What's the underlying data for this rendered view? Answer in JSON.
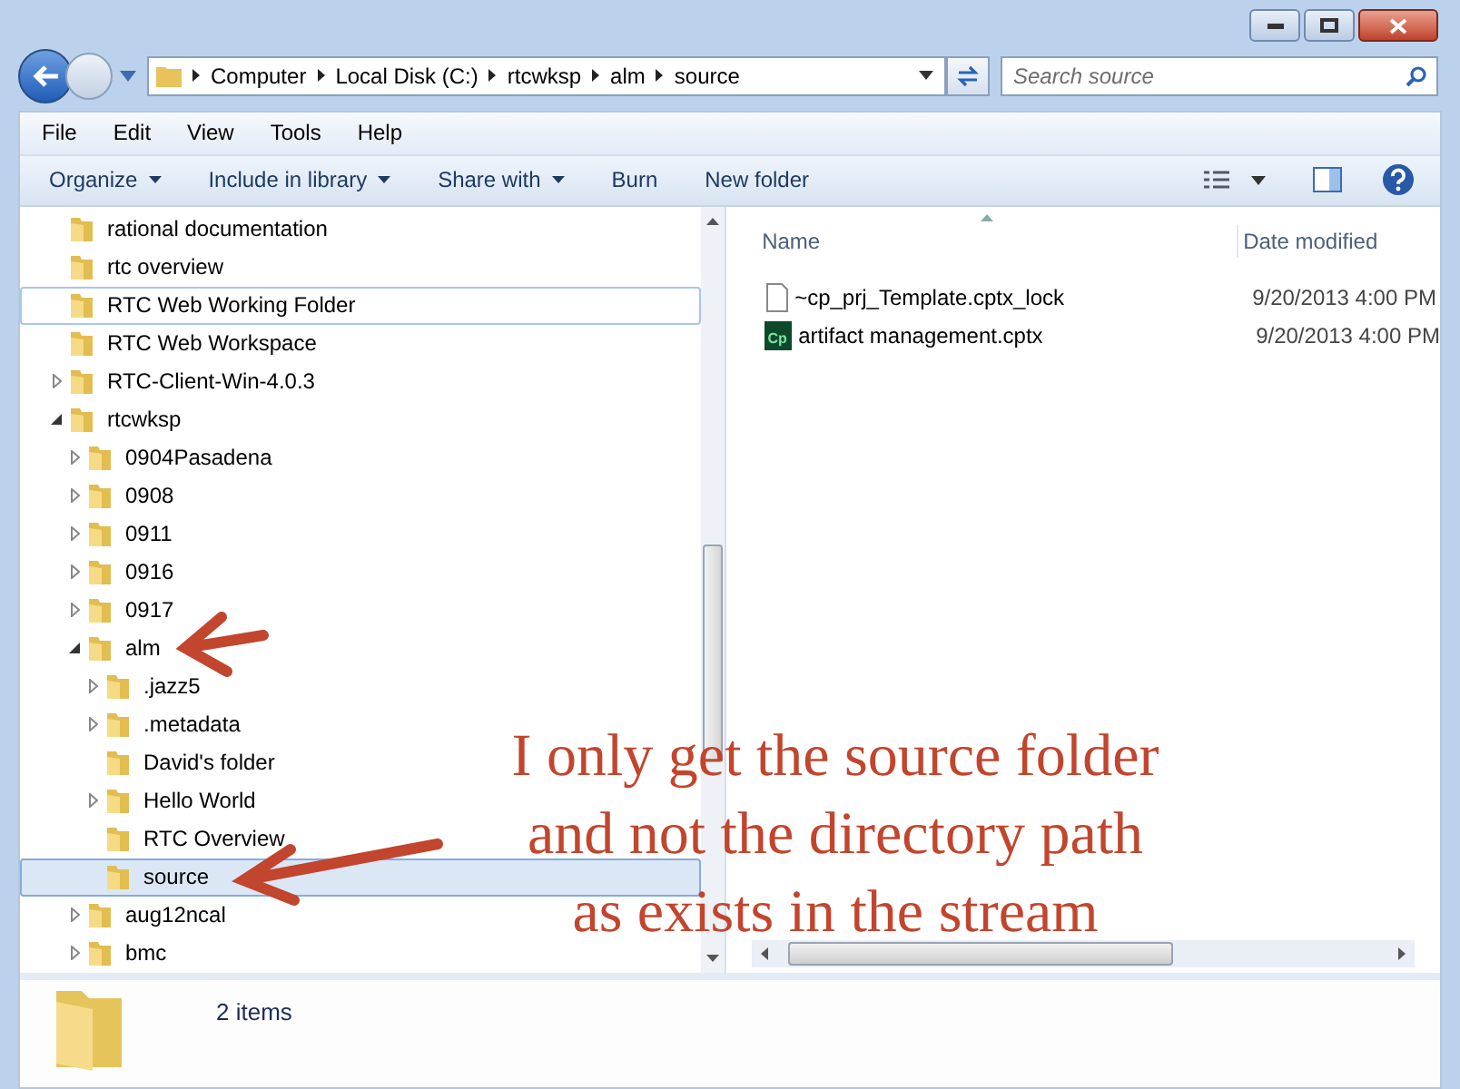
{
  "address_bar": {
    "segments": [
      "Computer",
      "Local Disk (C:)",
      "rtcwksp",
      "alm",
      "source"
    ]
  },
  "search": {
    "placeholder": "Search source"
  },
  "menu": [
    "File",
    "Edit",
    "View",
    "Tools",
    "Help"
  ],
  "toolbar": [
    {
      "label": "Organize",
      "dropdown": true
    },
    {
      "label": "Include in library",
      "dropdown": true
    },
    {
      "label": "Share with",
      "dropdown": true
    },
    {
      "label": "Burn",
      "dropdown": false
    },
    {
      "label": "New folder",
      "dropdown": false
    }
  ],
  "tree": [
    {
      "label": "rational documentation",
      "selected": false,
      "hovered": false
    },
    {
      "label": "rtc overview",
      "selected": false,
      "hovered": false
    },
    {
      "label": "RTC Web Working Folder",
      "selected": false,
      "hovered": true
    },
    {
      "label": "RTC Web Workspace",
      "selected": false,
      "hovered": false
    },
    {
      "label": "RTC-Client-Win-4.0.3",
      "selected": false,
      "hovered": false,
      "expanded": false
    },
    {
      "label": "rtcwksp",
      "selected": false,
      "hovered": false,
      "expanded": true,
      "children": [
        {
          "label": "0904Pasadena",
          "selected": false,
          "hovered": false,
          "expanded": false
        },
        {
          "label": "0908",
          "selected": false,
          "hovered": false,
          "expanded": false
        },
        {
          "label": "0911",
          "selected": false,
          "hovered": false,
          "expanded": false
        },
        {
          "label": "0916",
          "selected": false,
          "hovered": false,
          "expanded": false
        },
        {
          "label": "0917",
          "selected": false,
          "hovered": false,
          "expanded": false
        },
        {
          "label": "alm",
          "selected": false,
          "hovered": false,
          "expanded": true,
          "children": [
            {
              "label": ".jazz5",
              "selected": false,
              "hovered": false,
              "expanded": false
            },
            {
              "label": ".metadata",
              "selected": false,
              "hovered": false,
              "expanded": false
            },
            {
              "label": "David's folder",
              "selected": false,
              "hovered": false
            },
            {
              "label": "Hello World",
              "selected": false,
              "hovered": false,
              "expanded": false
            },
            {
              "label": "RTC Overview",
              "selected": false,
              "hovered": false
            },
            {
              "label": "source",
              "selected": true,
              "hovered": false
            }
          ]
        },
        {
          "label": "aug12ncal",
          "selected": false,
          "hovered": false,
          "expanded": false
        },
        {
          "label": "bmc",
          "selected": false,
          "hovered": false,
          "expanded": false
        }
      ]
    }
  ],
  "file_list": {
    "columns": [
      "Name",
      "Date modified"
    ],
    "rows": [
      {
        "name": "~cp_prj_Template.cptx_lock",
        "date": "9/20/2013 4:00 PM",
        "kind": "blank"
      },
      {
        "name": "artifact management.cptx",
        "date": "9/20/2013 4:00 PM",
        "kind": "captivate",
        "icon_text": "Cp"
      }
    ]
  },
  "details_pane": {
    "count": "2 items"
  },
  "annotation": {
    "lines": [
      "I only get the source folder",
      "and not the directory  path",
      "as exists in the stream"
    ]
  }
}
